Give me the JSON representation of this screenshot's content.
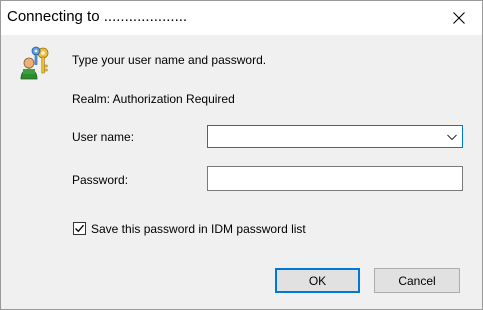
{
  "window": {
    "title": "Connecting to ....................",
    "close_icon": "close-icon"
  },
  "prompt": {
    "icon": "keys-user-icon",
    "message": "Type your user name and password.",
    "realm": "Realm: Authorization Required"
  },
  "form": {
    "username_label": "User name:",
    "username_value": "",
    "username_dropdown_icon": "chevron-down-icon",
    "password_label": "Password:",
    "password_value": ""
  },
  "options": {
    "save_password_label": "Save this password in IDM password list",
    "save_password_checked": true
  },
  "buttons": {
    "ok_label": "OK",
    "cancel_label": "Cancel"
  },
  "colors": {
    "focus_accent": "#0078d7",
    "dialog_background": "#f0f0f0"
  }
}
